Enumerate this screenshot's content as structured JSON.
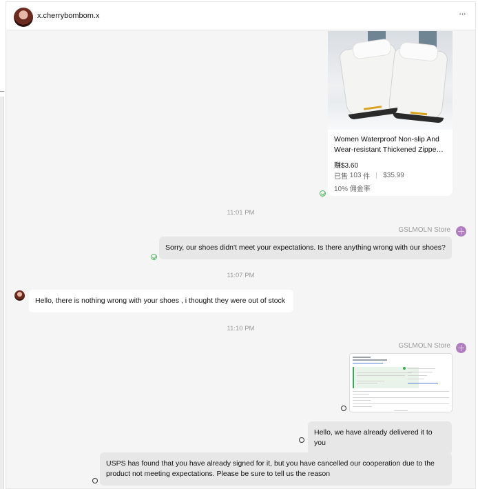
{
  "header": {
    "username": "x.cherrybombom.x",
    "more_label": "···"
  },
  "product": {
    "title": "Women Waterproof Non-slip And Wear-resistant Thickened Zippe…",
    "earn_label": "赚",
    "earn_value": "$3.60",
    "sold_label": "已售",
    "sold_count": "103",
    "sold_unit": "件",
    "price": "$35.99",
    "commission_value": "10%",
    "commission_label": "佣金率"
  },
  "messages": {
    "time_1": "11:01 PM",
    "store_name_1": "GSLMOLN Store",
    "store_msg_1": "Sorry, our shoes didn't meet your expectations. Is there anything wrong with our shoes?",
    "time_2": "11:07 PM",
    "user_msg_1": "Hello, there is nothing wrong with your shoes , i thought they were out of stock",
    "time_3": "11:10 PM",
    "store_name_2": "GSLMOLN Store",
    "store_msg_2": "Hello, we have already delivered it to you",
    "store_msg_3": "USPS has found that you have already signed for it, but you have cancelled our cooperation due to the product not meeting expectations. Please be sure to tell us the reason"
  }
}
